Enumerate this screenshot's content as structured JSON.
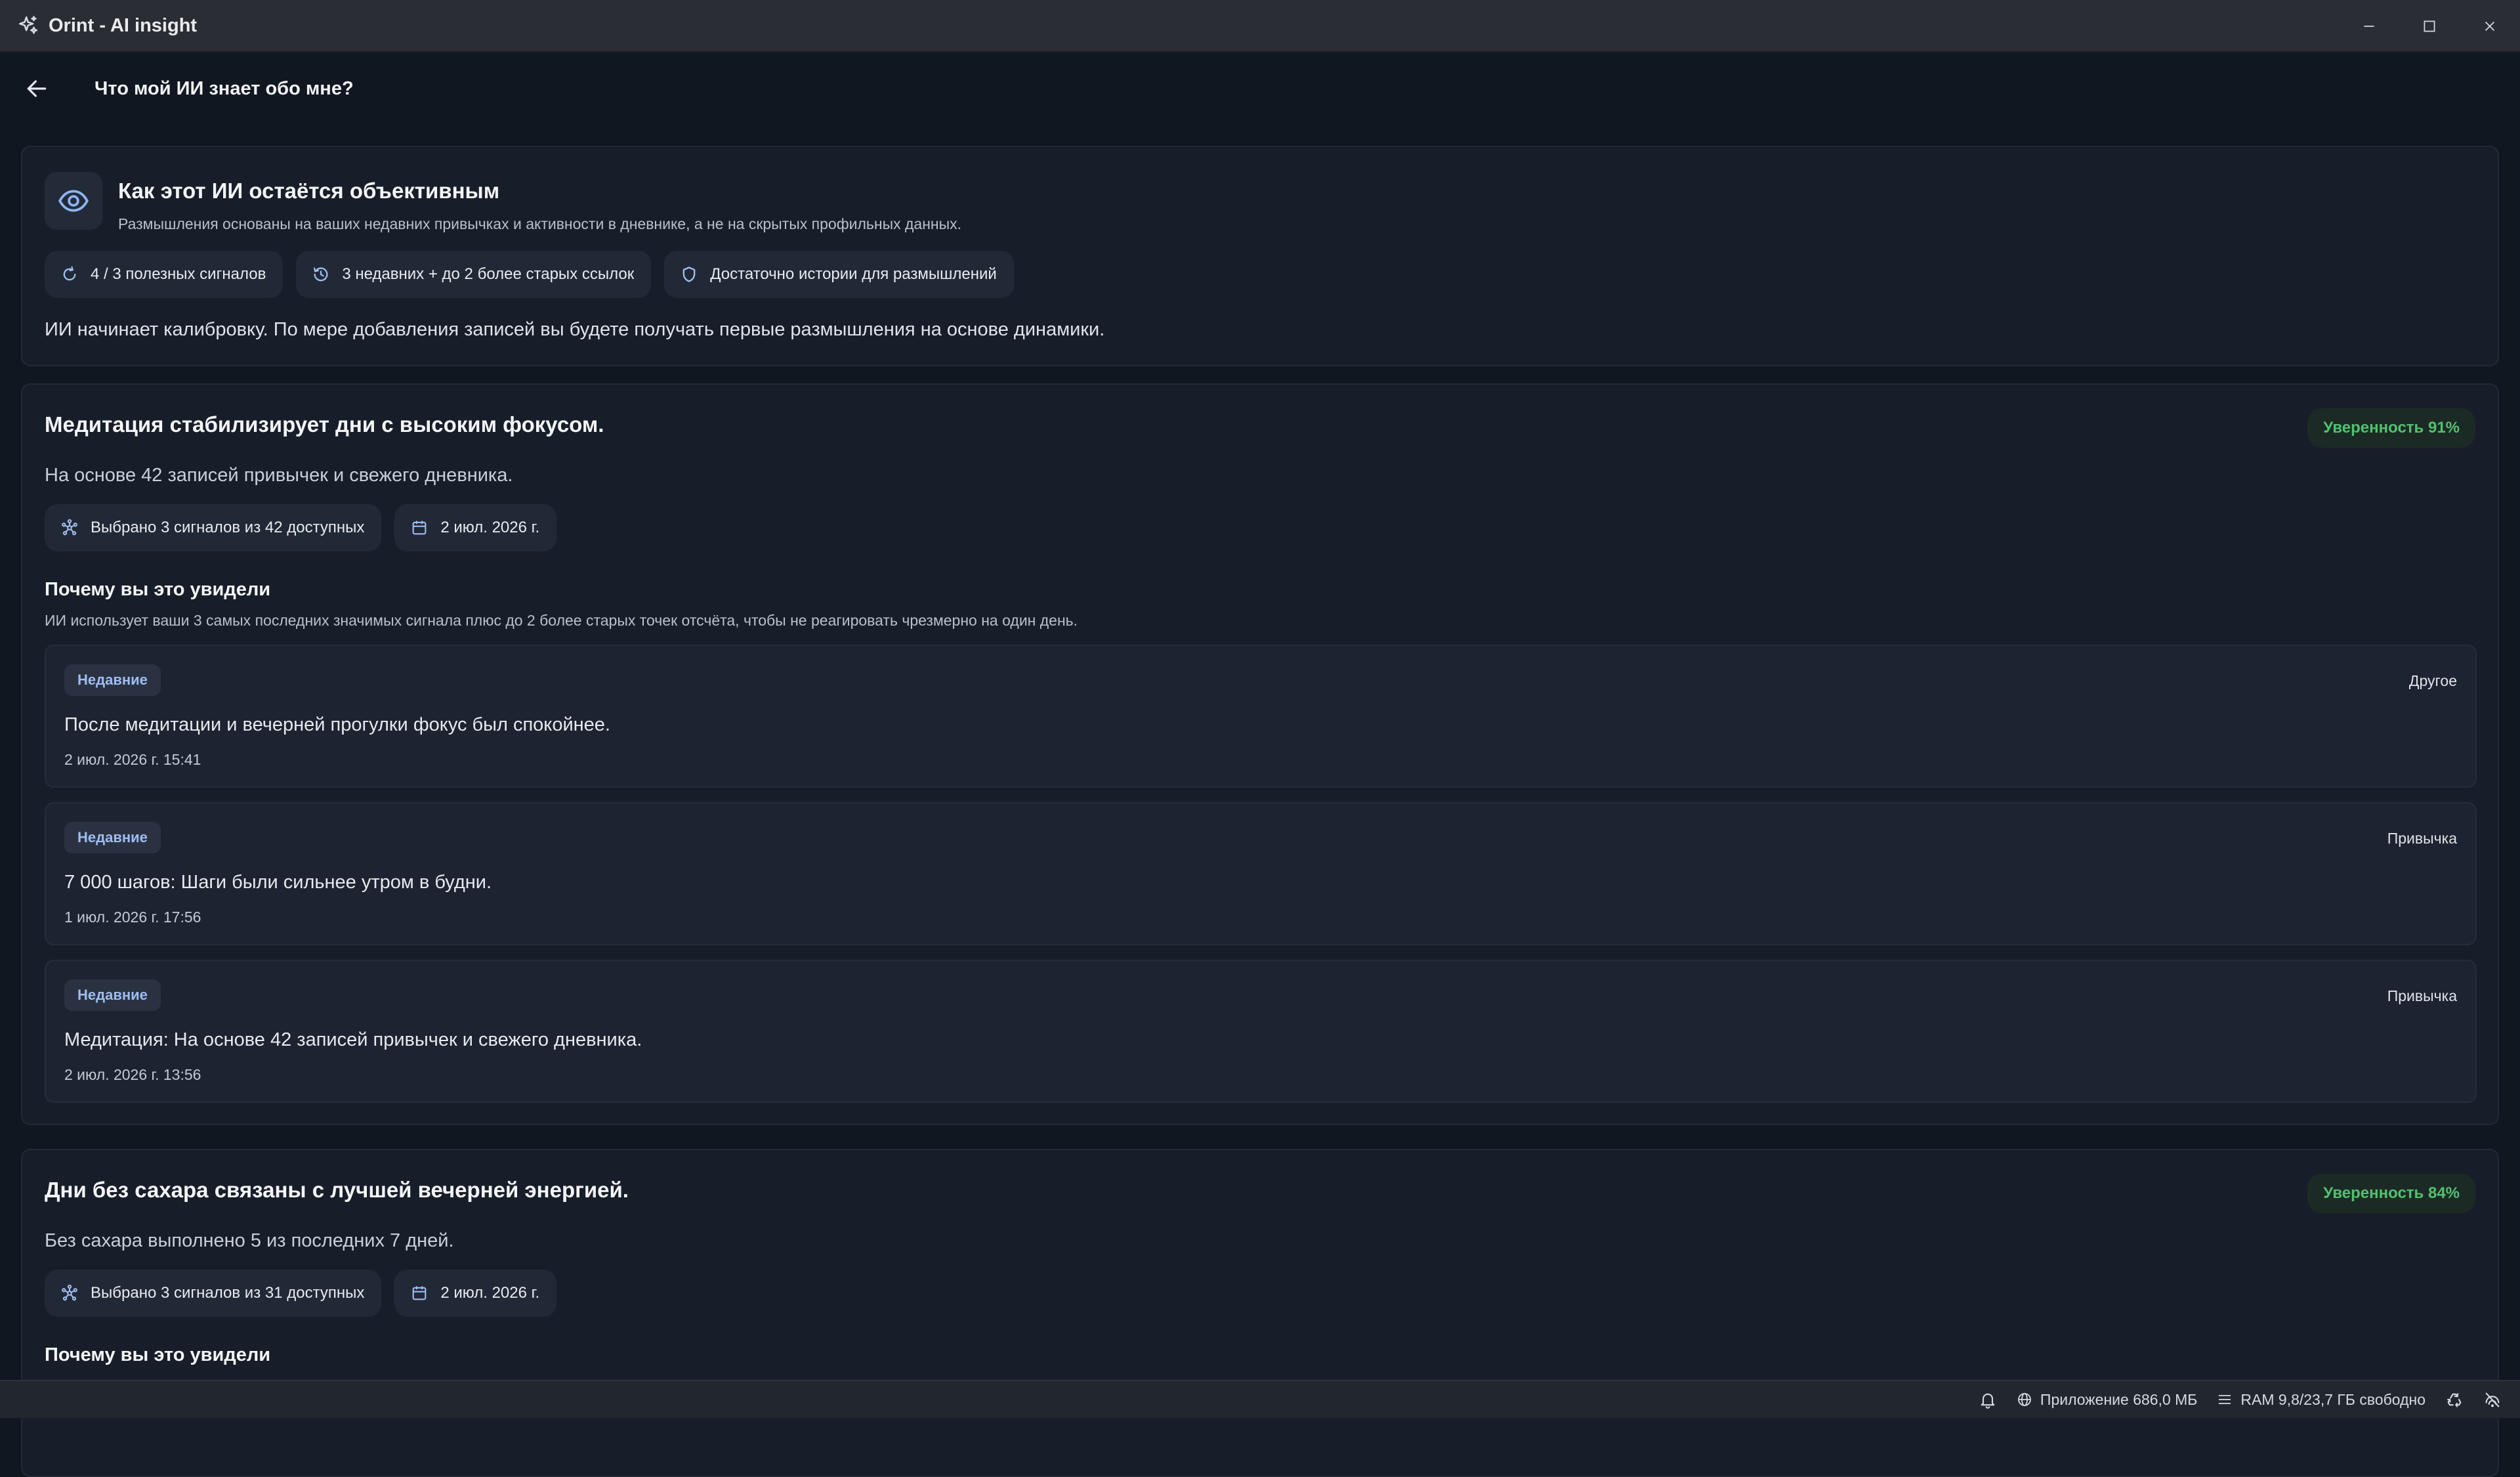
{
  "window": {
    "title": "Orint - AI insight"
  },
  "header": {
    "title": "Что мой ИИ знает обо мне?"
  },
  "objectivity": {
    "title": "Как этот ИИ остаётся объективным",
    "subtitle": "Размышления основаны на ваших недавних привычках и активности в дневнике, а не на скрытых профильных данных.",
    "chips": [
      {
        "icon": "refresh-icon",
        "label": "4 / 3 полезных сигналов"
      },
      {
        "icon": "history-icon",
        "label": "3 недавних + до 2 более старых ссылок"
      },
      {
        "icon": "shield-icon",
        "label": "Достаточно истории для размышлений"
      }
    ],
    "note": "ИИ начинает калибровку. По мере добавления записей вы будете получать первые размышления на основе динамики."
  },
  "insights": [
    {
      "title": "Медитация стабилизирует дни с высоким фокусом.",
      "confidence": "Уверенность 91%",
      "summary": "На основе 42 записей привычек и свежего дневника.",
      "signals_chip": "Выбрано 3 сигналов из 42 доступных",
      "date_chip": "2 июл. 2026 г.",
      "why_title": "Почему вы это увидели",
      "why_text": "ИИ использует ваши 3 самых последних значимых сигнала плюс до 2 более старых точек отсчёта, чтобы не реагировать чрезмерно на один день.",
      "signals": [
        {
          "badge": "Недавние",
          "kind": "Другое",
          "text": "После медитации и вечерней прогулки фокус был спокойнее.",
          "time": "2 июл. 2026 г. 15:41"
        },
        {
          "badge": "Недавние",
          "kind": "Привычка",
          "text": "7 000 шагов: Шаги были сильнее утром в будни.",
          "time": "1 июл. 2026 г. 17:56"
        },
        {
          "badge": "Недавние",
          "kind": "Привычка",
          "text": "Медитация: На основе 42 записей привычек и свежего дневника.",
          "time": "2 июл. 2026 г. 13:56"
        }
      ]
    },
    {
      "title": "Дни без сахара связаны с лучшей вечерней энергией.",
      "confidence": "Уверенность 84%",
      "summary": "Без сахара выполнено 5 из последних 7 дней.",
      "signals_chip": "Выбрано 3 сигналов из 31 доступных",
      "date_chip": "2 июл. 2026 г.",
      "why_title": "Почему вы это увидели"
    }
  ],
  "statusbar": {
    "app_memory": "Приложение 686,0 МБ",
    "ram": "RAM 9,8/23,7 ГБ свободно"
  },
  "colors": {
    "background": "#111721",
    "card": "#181e29",
    "accent_green": "#4fc36e",
    "badge_text": "#9fbdf0"
  }
}
